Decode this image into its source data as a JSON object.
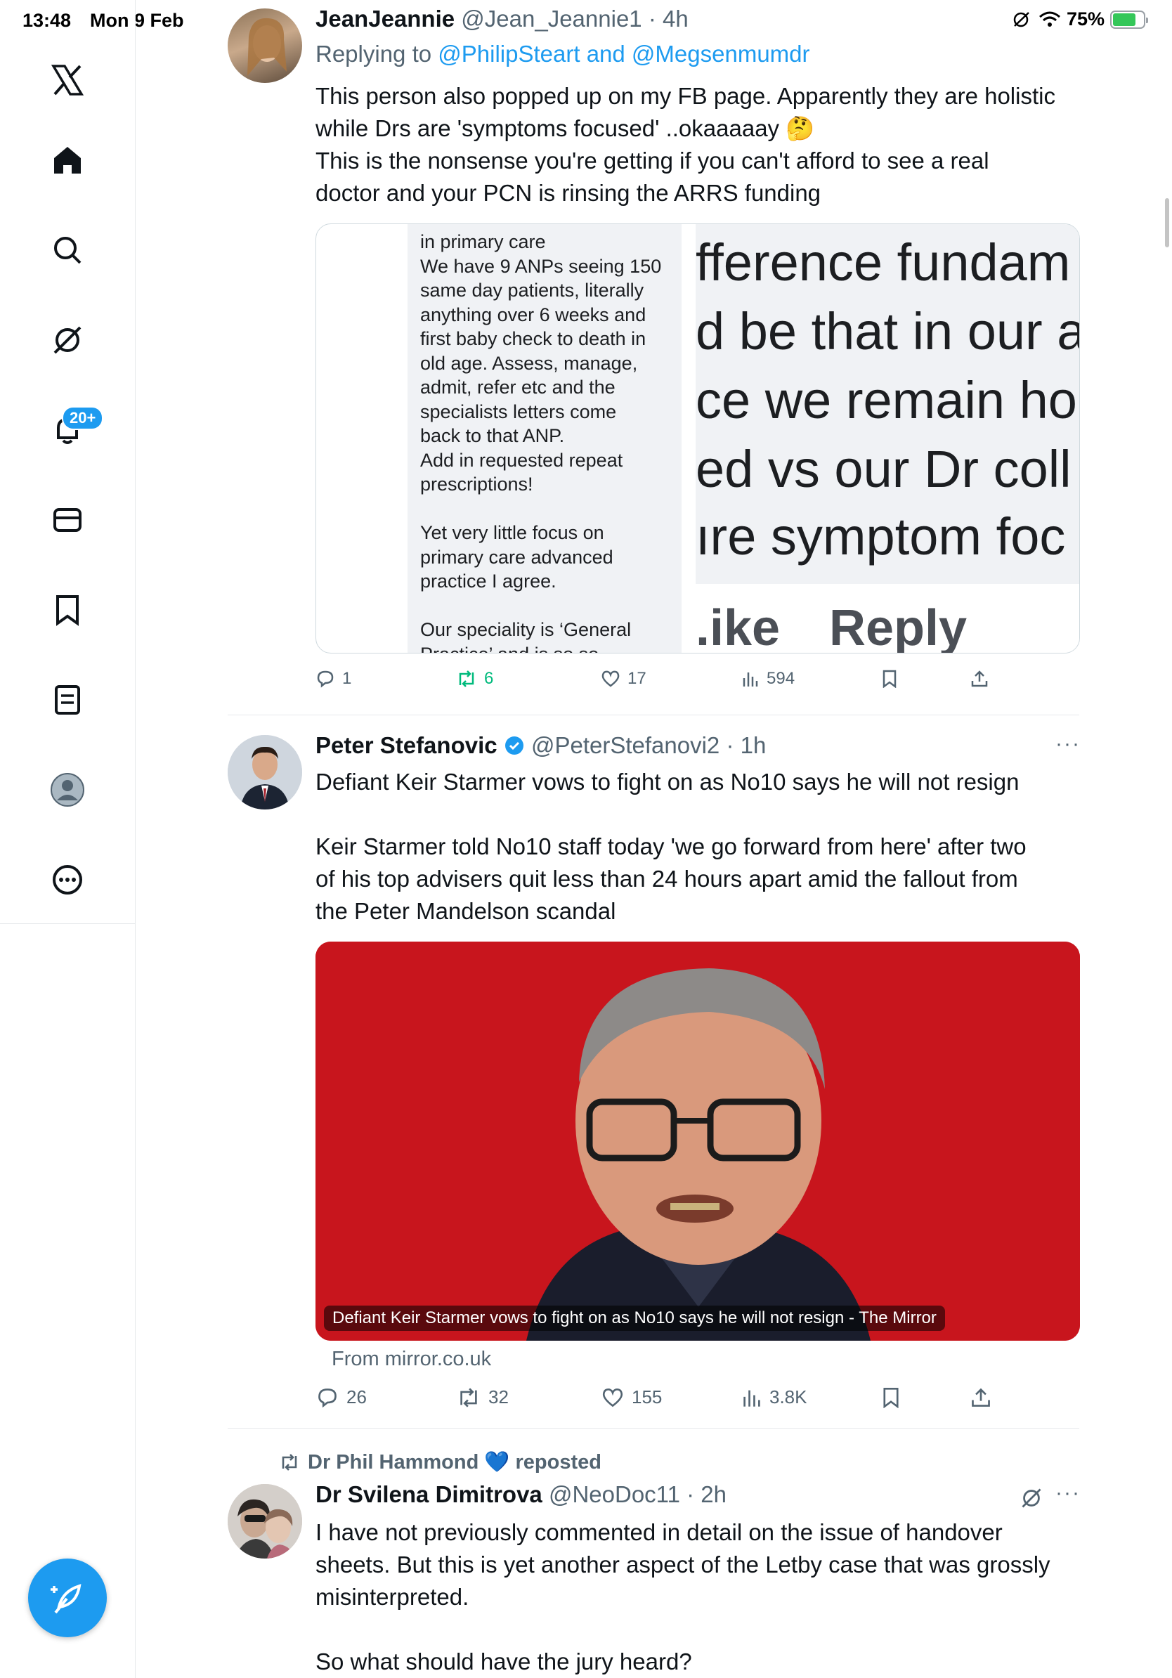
{
  "status": {
    "time": "13:48",
    "date": "Mon 9 Feb",
    "battery": "75%",
    "battery_level": 0.75
  },
  "sidebar": {
    "items": [
      "x-logo",
      "home-icon",
      "search-icon",
      "grok-icon",
      "notifications-icon",
      "messages-icon",
      "bookmarks-icon",
      "lists-icon",
      "profile-icon",
      "more-icon"
    ],
    "notifications_badge": "20+"
  },
  "posts": [
    {
      "name": "JeanJeannie",
      "handle": "@Jean_Jeannie1",
      "time": "4h",
      "replying_prefix": "Replying to",
      "replying_to": "@PhilipSteart and @Megsenmumdr",
      "text_line1": "This person also popped up on my FB page. Apparently they are holistic",
      "text_line2": "while Drs are 'symptoms focused' ..okaaaaay 🤔",
      "text_line3": "This is the nonsense you're getting if you can't afford to see a real",
      "text_line4": "doctor and your PCN is rinsing the ARRS funding",
      "card": {
        "left_lines": [
          "in primary care",
          "We have 9 ANPs seeing 150",
          "same day patients, literally",
          "anything over 6 weeks and",
          "first baby check to death in",
          "old age. Assess, manage,",
          "admit, refer etc and the",
          "specialists letters come",
          "back to that ANP.",
          "Add in requested repeat",
          "prescriptions!",
          "",
          "Yet very little focus on",
          "primary care advanced",
          "practice I agree.",
          "",
          "Our speciality is ‘General",
          "Practice’ and is so so"
        ],
        "right_lines": [
          "fference fundam",
          "d be that in our a",
          "ce we remain ho",
          "ed vs our Dr coll",
          "ıre symptom foc"
        ],
        "like": ".ike",
        "reply": "Reply"
      },
      "stats": {
        "replies": "1",
        "reposts": "6",
        "likes": "17",
        "views": "594"
      }
    },
    {
      "name": "Peter Stefanovic",
      "handle": "@PeterStefanovi2",
      "time": "1h",
      "text_line1": "Defiant Keir Starmer vows to fight on as No10 says he will not resign",
      "text_line2": "Keir Starmer told No10 staff today 'we go forward from here' after two",
      "text_line3": "of his top advisers quit less than 24 hours apart amid the fallout from",
      "text_line4": "the Peter Mandelson scandal",
      "card_caption": "Defiant Keir Starmer vows to fight on as No10 says he will not resign - The Mirror",
      "card_source": "From mirror.co.uk",
      "stats": {
        "replies": "26",
        "reposts": "32",
        "likes": "155",
        "views": "3.8K"
      }
    },
    {
      "reposted_by": "Dr Phil Hammond 💙 reposted",
      "name": "Dr Svilena Dimitrova",
      "handle": "@NeoDoc11",
      "time": "2h",
      "text_line1": "I have not previously commented in detail on the issue of handover",
      "text_line2": "sheets. But this is yet another aspect of the Letby case that was grossly",
      "text_line3": "misinterpreted.",
      "text_line4": "So what should have the jury heard?"
    }
  ],
  "colors": {
    "accent": "#1d9bf0",
    "repost_green": "#00ba7c",
    "muted": "#536471",
    "mirror_red": "#c8151d"
  }
}
